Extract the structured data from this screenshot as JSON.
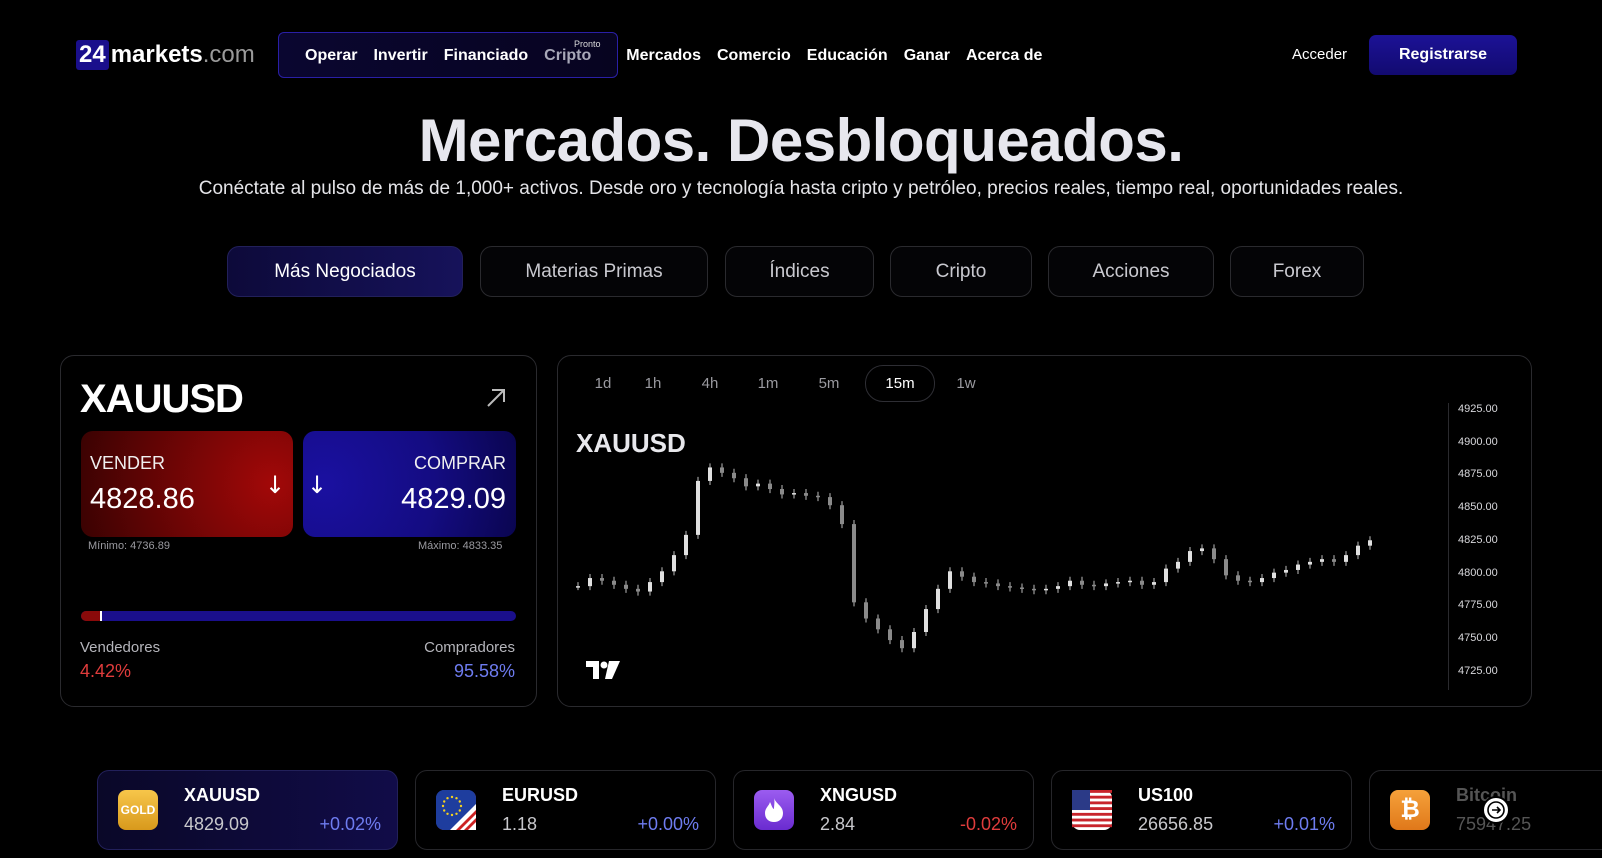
{
  "nav": {
    "logo_num": "24",
    "logo_name": "markets",
    "logo_tld": ".com",
    "items": [
      {
        "label": "Operar"
      },
      {
        "label": "Invertir"
      },
      {
        "label": "Financiado"
      },
      {
        "label": "Cripto",
        "badge": "Pronto"
      },
      {
        "label": "Mercados"
      },
      {
        "label": "Comercio"
      },
      {
        "label": "Educación"
      },
      {
        "label": "Ganar"
      },
      {
        "label": "Acerca de"
      }
    ],
    "login": "Acceder",
    "signup": "Registrarse"
  },
  "hero": {
    "title": "Mercados. Desbloqueados.",
    "subtitle": "Conéctate al pulso de más de 1,000+ activos. Desde oro y tecnología hasta cripto y petróleo, precios reales, tiempo real, oportunidades reales."
  },
  "tabs": [
    {
      "label": "Más Negociados",
      "active": true
    },
    {
      "label": "Materias Primas"
    },
    {
      "label": "Índices"
    },
    {
      "label": "Cripto"
    },
    {
      "label": "Acciones"
    },
    {
      "label": "Forex"
    }
  ],
  "instrument": {
    "symbol": "XAUUSD",
    "sell_label": "VENDER",
    "sell_price": "4828.86",
    "buy_label": "COMPRAR",
    "buy_price": "4829.09",
    "low": "Mínimo: 4736.89",
    "high": "Máximo: 4833.35",
    "sellers_label": "Vendedores",
    "sellers_pct": "4.42%",
    "buyers_label": "Compradores",
    "buyers_pct": "95.58%",
    "sellers_fraction": 0.0442
  },
  "chart": {
    "symbol": "XAUUSD",
    "timeframes": [
      {
        "label": "1d"
      },
      {
        "label": "1h"
      },
      {
        "label": "4h"
      },
      {
        "label": "1m"
      },
      {
        "label": "5m"
      },
      {
        "label": "15m",
        "active": true
      },
      {
        "label": "1w"
      }
    ],
    "price_ticks": [
      "4925.00",
      "4900.00",
      "4875.00",
      "4850.00",
      "4825.00",
      "4800.00",
      "4775.00",
      "4750.00",
      "4725.00"
    ]
  },
  "chart_data": {
    "type": "line",
    "title": "XAUUSD",
    "xlabel": "",
    "ylabel": "",
    "ylim": [
      4715,
      4930
    ],
    "y_ticks": [
      4925,
      4900,
      4875,
      4850,
      4825,
      4800,
      4775,
      4750,
      4725
    ],
    "series": [
      {
        "values": [
          4792,
          4798,
          4796,
          4793,
          4790,
          4788,
          4795,
          4803,
          4815,
          4830,
          4870,
          4880,
          4876,
          4872,
          4866,
          4868,
          4864,
          4860,
          4861,
          4859,
          4858,
          4852,
          4838,
          4780,
          4768,
          4760,
          4752,
          4746,
          4758,
          4775,
          4790,
          4803,
          4799,
          4795,
          4794,
          4792,
          4791,
          4790,
          4789,
          4790,
          4792,
          4796,
          4793,
          4792,
          4794,
          4795,
          4796,
          4793,
          4795,
          4805,
          4810,
          4818,
          4820,
          4812,
          4800,
          4796,
          4795,
          4798,
          4802,
          4804,
          4808,
          4810,
          4812,
          4810,
          4815,
          4822,
          4826
        ]
      }
    ]
  },
  "tickers": [
    {
      "icon": "gold-icon",
      "icon_text": "GOLD",
      "name": "XAUUSD",
      "price": "4829.09",
      "change": "+0.02%",
      "dir": "up",
      "active": true
    },
    {
      "icon": "eu-us-flag-icon",
      "icon_text": "",
      "name": "EURUSD",
      "price": "1.18",
      "change": "+0.00%",
      "dir": "up"
    },
    {
      "icon": "flame-icon",
      "icon_text": "",
      "name": "XNGUSD",
      "price": "2.84",
      "change": "-0.02%",
      "dir": "down"
    },
    {
      "icon": "us-flag-icon",
      "icon_text": "",
      "name": "US100",
      "price": "26656.85",
      "change": "+0.01%",
      "dir": "up"
    },
    {
      "icon": "bitcoin-icon",
      "icon_text": "₿",
      "name": "Bitcoin",
      "price": "75947.25",
      "change": "",
      "dir": "up"
    }
  ],
  "colors": {
    "accent": "#1a0f8c",
    "sell": "#8a0a0a",
    "up": "#6e7cf0",
    "down": "#e03c3c"
  }
}
